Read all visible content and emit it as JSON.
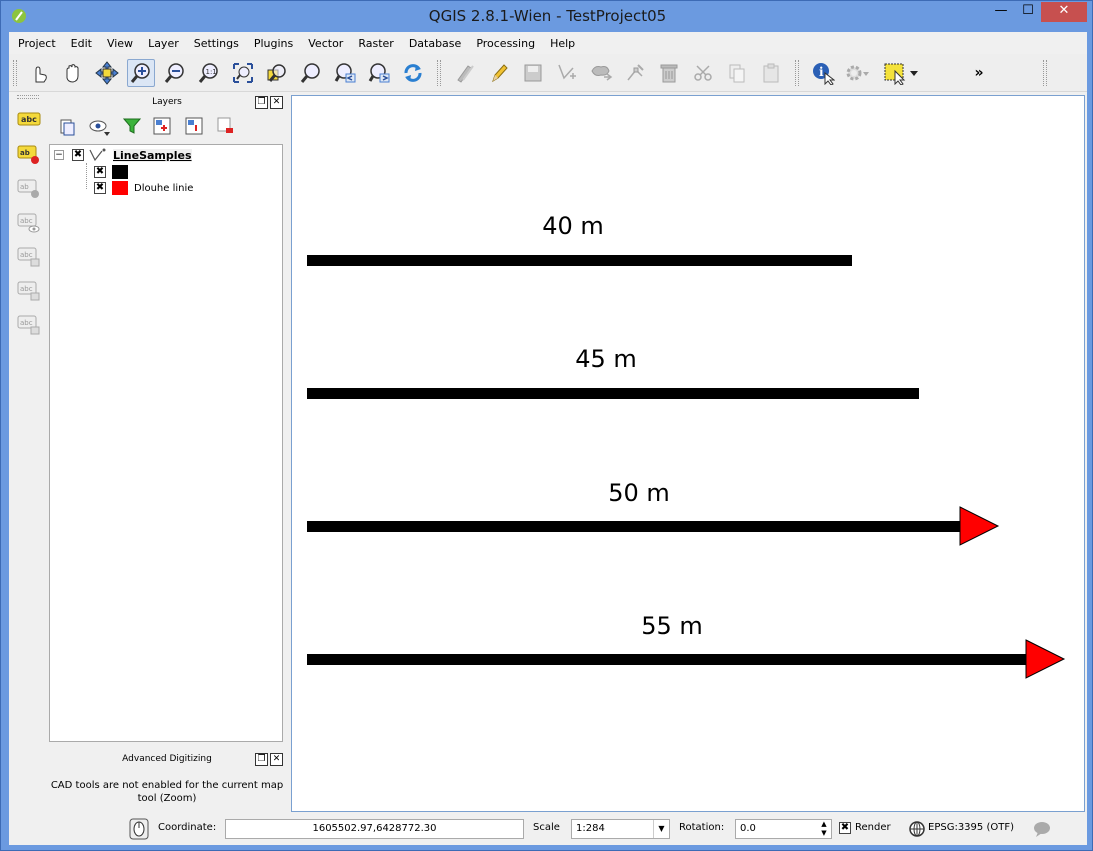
{
  "window": {
    "title": "QGIS 2.8.1-Wien - TestProject05",
    "minimize": "—",
    "maximize": "☐",
    "close": "✕"
  },
  "menu": [
    "Project",
    "Edit",
    "View",
    "Layer",
    "Settings",
    "Plugins",
    "Vector",
    "Raster",
    "Database",
    "Processing",
    "Help"
  ],
  "toolbar": {
    "overflow": "»"
  },
  "layers_panel": {
    "title": "Layers",
    "layer_name": "LineSamples",
    "classes": [
      {
        "label": "",
        "color": "#000000"
      },
      {
        "label": "Dlouhe linie",
        "color": "#ff0000"
      }
    ]
  },
  "advanced_digitizing": {
    "title": "Advanced Digitizing",
    "message": "CAD tools are not enabled for the current map tool (Zoom)"
  },
  "map": {
    "lines": [
      {
        "label": "40 m",
        "arrow": false
      },
      {
        "label": "45 m",
        "arrow": false
      },
      {
        "label": "50 m",
        "arrow": true
      },
      {
        "label": "55 m",
        "arrow": true
      }
    ],
    "line_color": "#000000",
    "arrow_color": "#ff0000"
  },
  "status": {
    "coordinate_label": "Coordinate:",
    "coordinate_value": "1605502.97,6428772.30",
    "scale_label": "Scale",
    "scale_value": "1:284",
    "rotation_label": "Rotation:",
    "rotation_value": "0.0",
    "render_label": "Render",
    "crs": "EPSG:3395 (OTF)"
  }
}
